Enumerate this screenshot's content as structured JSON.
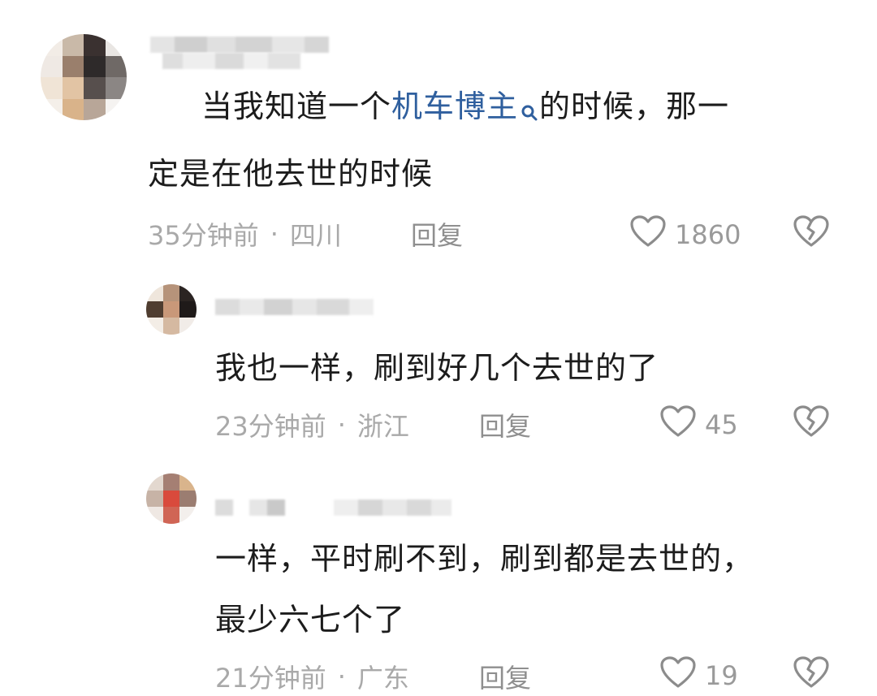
{
  "comments": [
    {
      "text_pre": "当我知道一个",
      "text_link": "机车博主",
      "text_post": "的时候，那一",
      "text_line2": "定是在他去世的时候",
      "time": "35分钟前",
      "location": "四川",
      "reply_label": "回复",
      "likes": "1860"
    },
    {
      "text_line1": "我也一样，刷到好几个去世的了",
      "time": "23分钟前",
      "location": "浙江",
      "reply_label": "回复",
      "likes": "45"
    },
    {
      "text_line1": "一样，平时刷不到，刷到都是去世的，",
      "text_line2": "最少六七个了",
      "time": "21分钟前",
      "location": "广东",
      "reply_label": "回复",
      "likes": "19"
    }
  ],
  "icons": {
    "like": "heart-outline-icon",
    "dislike": "broken-heart-icon",
    "search": "search-icon"
  },
  "colors": {
    "link": "#2f5f9e",
    "meta": "#a9a9a9",
    "text": "#1c1c1c"
  }
}
